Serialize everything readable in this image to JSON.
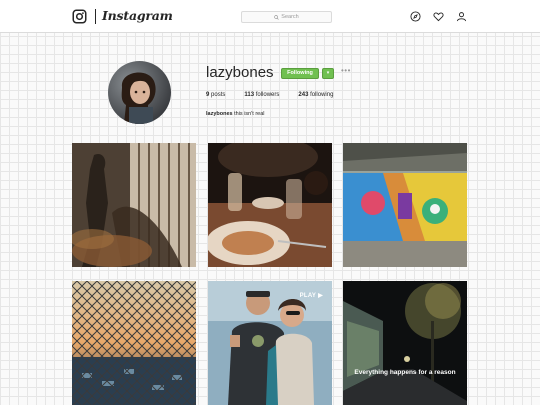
{
  "header": {
    "app_name": "Instagram",
    "search": {
      "placeholder": "Search"
    },
    "nav_icons": [
      "compass-icon",
      "heart-icon",
      "person-icon"
    ]
  },
  "profile": {
    "username": "lazybones",
    "follow_button_label": "Following",
    "dropdown_glyph": "▾",
    "more_glyph": "•••",
    "stats": {
      "posts": "9",
      "posts_label": "posts",
      "followers": "113",
      "followers_label": "followers",
      "following": "243",
      "following_label": "following"
    },
    "bio": {
      "name": "lazybones",
      "text": "this isn't real"
    }
  },
  "posts": [
    {
      "subject": "shadow on wooden fence"
    },
    {
      "subject": "restaurant table dinner"
    },
    {
      "subject": "colorful mural under bridge"
    },
    {
      "subject": "chain link fence at sunset"
    },
    {
      "subject": "couple selfie",
      "badge": "PLAY ▶"
    },
    {
      "subject": "dark alley at night",
      "caption": "Everything happens for a reason"
    }
  ],
  "colors": {
    "accent_green": "#70c050",
    "border": "#dbdbdb",
    "text": "#262626"
  }
}
